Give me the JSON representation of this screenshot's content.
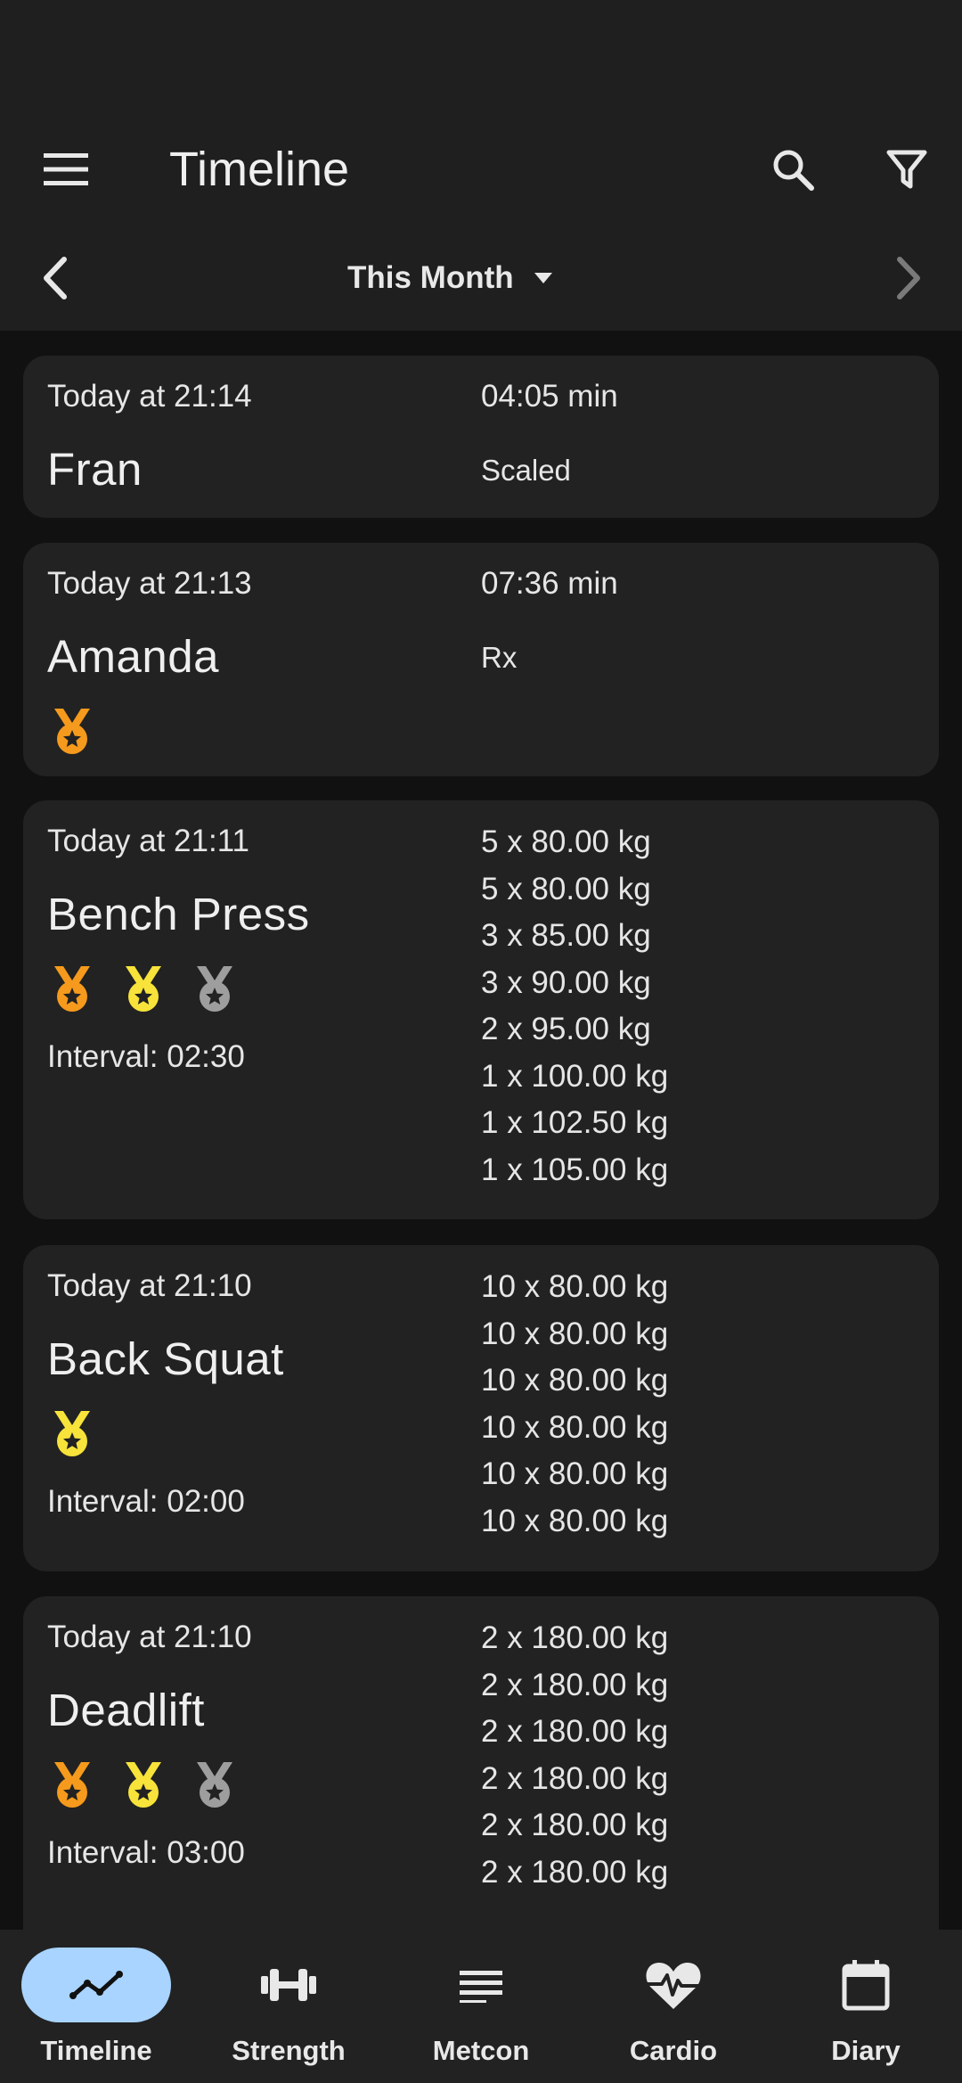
{
  "header": {
    "title": "Timeline"
  },
  "period": {
    "label": "This Month"
  },
  "entries": [
    {
      "date": "Today at 21:14",
      "name": "Fran",
      "result": "04:05 min",
      "scale": "Scaled"
    },
    {
      "date": "Today at 21:13",
      "name": "Amanda",
      "result": "07:36 min",
      "scale": "Rx",
      "medals": [
        "bronze"
      ]
    },
    {
      "date": "Today at 21:11",
      "name": "Bench Press",
      "medals": [
        "bronze",
        "gold",
        "silver"
      ],
      "interval": "Interval: 02:30",
      "sets": [
        "5 x 80.00 kg",
        "5 x 80.00 kg",
        "3 x 85.00 kg",
        "3 x 90.00 kg",
        "2 x 95.00 kg",
        "1 x 100.00 kg",
        "1 x 102.50 kg",
        "1 x 105.00 kg"
      ]
    },
    {
      "date": "Today at 21:10",
      "name": "Back Squat",
      "medals": [
        "gold"
      ],
      "interval": "Interval: 02:00",
      "sets": [
        "10 x 80.00 kg",
        "10 x 80.00 kg",
        "10 x 80.00 kg",
        "10 x 80.00 kg",
        "10 x 80.00 kg",
        "10 x 80.00 kg"
      ]
    },
    {
      "date": "Today at 21:10",
      "name": "Deadlift",
      "medals": [
        "bronze",
        "gold",
        "silver"
      ],
      "interval": "Interval: 03:00",
      "sets": [
        "2 x 180.00 kg",
        "2 x 180.00 kg",
        "2 x 180.00 kg",
        "2 x 180.00 kg",
        "2 x 180.00 kg",
        "2 x 180.00 kg"
      ]
    }
  ],
  "nav": [
    {
      "label": "Timeline",
      "icon": "trend-icon",
      "active": true
    },
    {
      "label": "Strength",
      "icon": "dumbbell-icon"
    },
    {
      "label": "Metcon",
      "icon": "notes-icon"
    },
    {
      "label": "Cardio",
      "icon": "heartbeat-icon"
    },
    {
      "label": "Diary",
      "icon": "calendar-icon"
    }
  ],
  "colors": {
    "accent": "#a8d4ff",
    "bronze": "#f59a1c",
    "gold": "#f7e33a",
    "silver": "#9e9e9e",
    "card": "#222222",
    "background": "#111111"
  }
}
